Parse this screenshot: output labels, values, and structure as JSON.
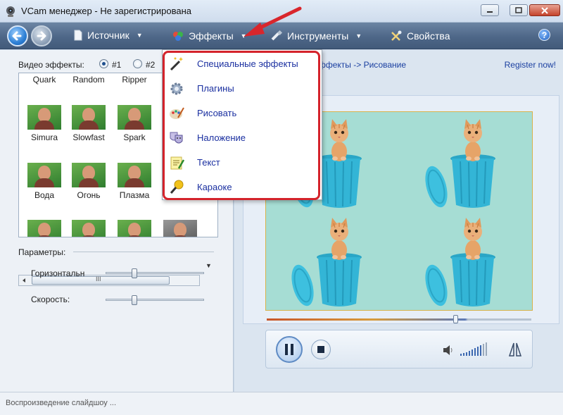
{
  "window": {
    "title": "VCam менеджер - Не зарегистрирована"
  },
  "toolbar": {
    "items": [
      {
        "label": "Источник",
        "icon": "page-icon"
      },
      {
        "label": "Эффекты",
        "icon": "effects-icon"
      },
      {
        "label": "Инструменты",
        "icon": "tools-icon"
      },
      {
        "label": "Свойства",
        "icon": "wrench-icon"
      }
    ],
    "help_label": "?"
  },
  "left": {
    "video_effects_label": "Видео эффекты:",
    "radio1": "#1",
    "radio2": "#2",
    "effects": [
      {
        "name": "Quark"
      },
      {
        "name": "Random"
      },
      {
        "name": "Ripper"
      },
      {
        "name": "Simura"
      },
      {
        "name": "Slowfast"
      },
      {
        "name": "Spark"
      },
      {
        "name": "Вода"
      },
      {
        "name": "Огонь"
      },
      {
        "name": "Плазма"
      }
    ],
    "params_label": "Параметры:",
    "slider1_label": "Горизонтальн",
    "slider1_value": 0.27,
    "slider2_label": "Скорость:",
    "slider2_value": 0.27,
    "hscroll_grip": "III"
  },
  "right": {
    "breadcrumb": "ффекты -> Рисование",
    "register": "Register now!",
    "seek_progress": 0.72
  },
  "menu": {
    "items": [
      {
        "label": "Специальные эффекты",
        "icon": "magic-wand-icon"
      },
      {
        "label": "Плагины",
        "icon": "plugins-gear-icon"
      },
      {
        "label": "Рисовать",
        "icon": "palette-icon"
      },
      {
        "label": "Наложение",
        "icon": "theater-masks-icon"
      },
      {
        "label": "Текст",
        "icon": "text-note-icon"
      },
      {
        "label": "Караоке",
        "icon": "microphone-icon"
      }
    ]
  },
  "status": {
    "text": "Воспроизведение слайдшоу ..."
  },
  "colors": {
    "accent": "#1a3fa0",
    "highlight": "#d4232b"
  }
}
